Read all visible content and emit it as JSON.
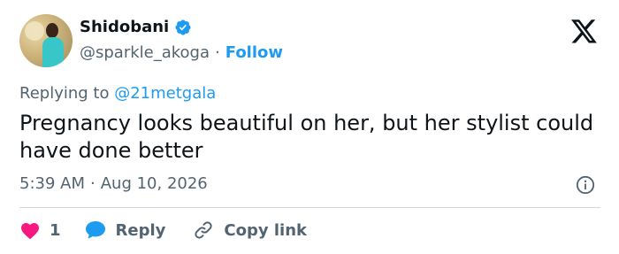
{
  "author": {
    "name": "Shidobani",
    "handle": "@sparkle_akoga",
    "separator": "·",
    "follow_label": "Follow"
  },
  "reply_context": {
    "prefix": "Replying to",
    "mention": "@21metgala"
  },
  "tweet": {
    "text": "Pregnancy looks beautiful on her, but her stylist could have done better",
    "time": "5:39 AM",
    "separator": "·",
    "date": "Aug 10, 2026"
  },
  "actions": {
    "like_count": "1",
    "reply_label": "Reply",
    "copy_link_label": "Copy link"
  },
  "icons": {
    "verified": "verified-badge-icon",
    "logo": "x-logo-icon",
    "info": "info-icon",
    "like": "heart-icon",
    "reply": "speech-bubble-icon",
    "copy": "link-icon"
  },
  "colors": {
    "accent": "#1d9bf0",
    "like": "#f91880",
    "secondary_text": "#536471",
    "primary_text": "#0f1419"
  }
}
